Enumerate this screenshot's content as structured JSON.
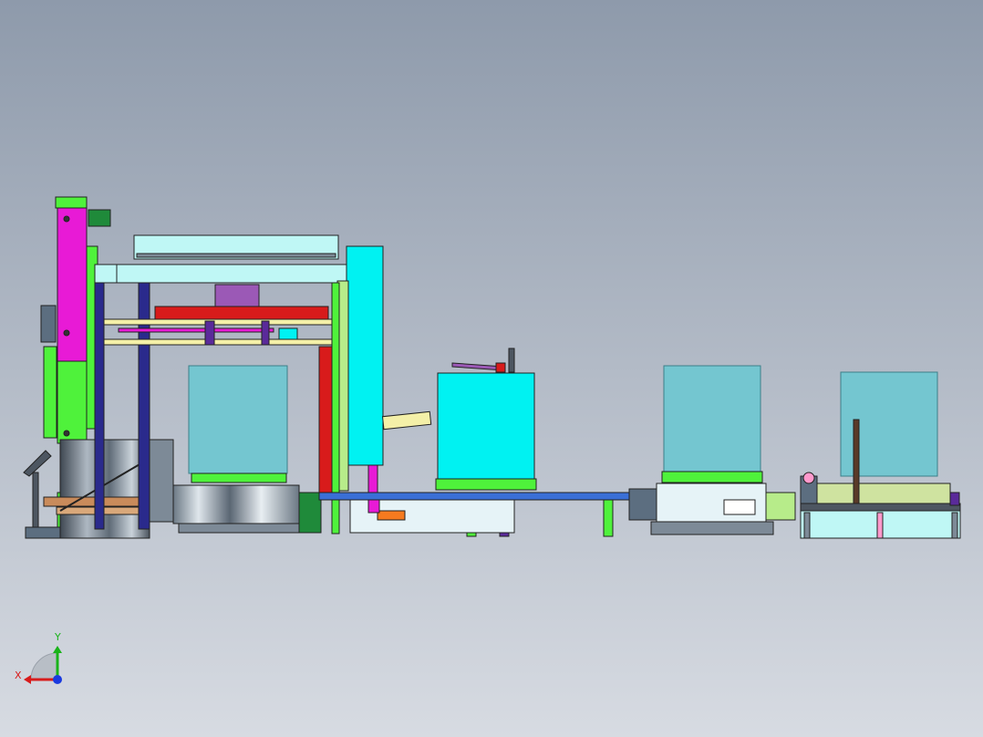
{
  "viewport": {
    "background_top": "#8e9aab",
    "background_bottom": "#d7dbe2"
  },
  "colors": {
    "outline": "#222222",
    "magenta": "#e81ad6",
    "lime": "#4ff23b",
    "cyan": "#00f2f2",
    "aqua_light": "#bff7f5",
    "teal_box": "#74c6d0",
    "teal_box_edge": "#3c7f89",
    "navy": "#2a2a8c",
    "blue_rail": "#3a6fd6",
    "red": "#d81b1b",
    "purple": "#9b59b6",
    "dark_purple": "#5a2a9a",
    "steel": "#7d8a97",
    "steel_dark": "#4d5661",
    "light_green": "#b7ec8a",
    "light_olive": "#cfe3a0",
    "pale_yellow": "#f4f0a8",
    "orange": "#f57a1f",
    "pink": "#ff99cc",
    "white_panel": "#e6f3f7",
    "green_dark": "#1f8a3a",
    "grey_blue": "#5c6e80"
  },
  "triad": {
    "x_label": "X",
    "y_label": "Y",
    "x_color": "#d81b1b",
    "y_color": "#19b319",
    "z_color": "#1a3adf"
  }
}
